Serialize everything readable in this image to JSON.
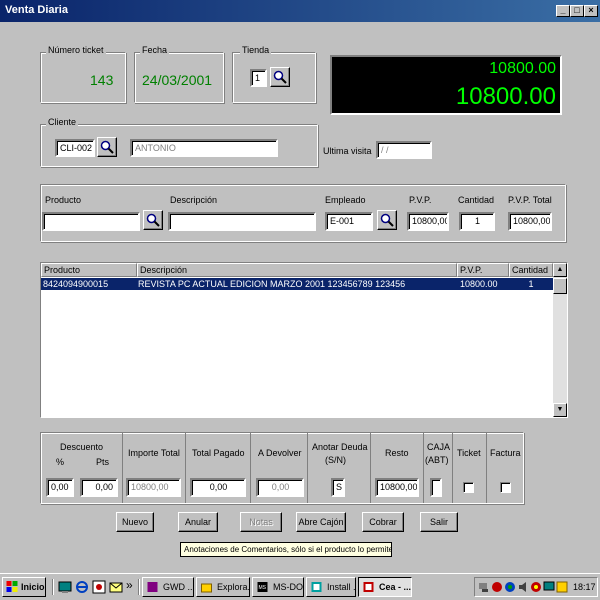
{
  "window": {
    "title": "Venta Diaria"
  },
  "ticket": {
    "label": "Número ticket",
    "value": "143"
  },
  "fecha": {
    "label": "Fecha",
    "value": "24/03/2001"
  },
  "tienda": {
    "label": "Tienda",
    "value": "1"
  },
  "display": {
    "line1": "10800.00",
    "line2": "10800.00"
  },
  "cliente": {
    "label": "Cliente",
    "code": "CLI-002",
    "name": "ANTONIO"
  },
  "ultima_visita": {
    "label": "Ultima visita",
    "value": " /  / "
  },
  "producto_form": {
    "producto_label": "Producto",
    "producto_value": "",
    "descripcion_label": "Descripción",
    "descripcion_value": "",
    "empleado_label": "Empleado",
    "empleado_value": "E-001",
    "pvp_label": "P.V.P.",
    "pvp_value": "10800,00",
    "cantidad_label": "Cantidad",
    "cantidad_value": "1",
    "pvp_total_label": "P.V.P. Total",
    "pvp_total_value": "10800,00"
  },
  "grid": {
    "headers": [
      "Producto",
      "Descripción",
      "P.V.P.",
      "Cantidad"
    ],
    "rows": [
      {
        "producto": "8424094900015",
        "descripcion": "REVISTA PC ACTUAL  EDICION MARZO 2001  123456789 123456",
        "pvp": "10800.00",
        "cantidad": "1"
      }
    ]
  },
  "totals": {
    "descuento_label": "Descuento",
    "pct_label": "%",
    "pts_label": "Pts",
    "descuento_pct": "0,00",
    "descuento_pts": "0,00",
    "importe_total_label": "Importe Total",
    "importe_total": "10800,00",
    "total_pagado_label": "Total Pagado",
    "total_pagado": "0,00",
    "a_devolver_label": "A Devolver",
    "a_devolver": "0,00",
    "anotar_deuda_label": "Anotar Deuda",
    "anotar_deuda_sub": "(S/N)",
    "anotar_deuda": "S",
    "resto_label": "Resto",
    "resto": "10800,00",
    "caja_label": "CAJA",
    "caja_sub": "(ABT)",
    "caja": "",
    "ticket_label": "Ticket",
    "factura_label": "Factura"
  },
  "buttons": {
    "nuevo": "Nuevo",
    "anular": "Anular",
    "notas": "Notas",
    "abre_cajon": "Abre Cajón",
    "cobrar": "Cobrar",
    "salir": "Salir"
  },
  "tooltip": "Anotaciones de Comentarios, sólo si el producto lo permite",
  "taskbar": {
    "start": "Inicio",
    "chevron": "»",
    "tasks": [
      "GWD ...",
      "Explora...",
      "MS-DOS",
      "Install ...",
      "Cea - ..."
    ],
    "clock": "18:17"
  },
  "colors": {
    "titlebar": "#0a246a",
    "display_text": "#00ff00",
    "value_green": "#008000",
    "selection": "#0a246a"
  }
}
